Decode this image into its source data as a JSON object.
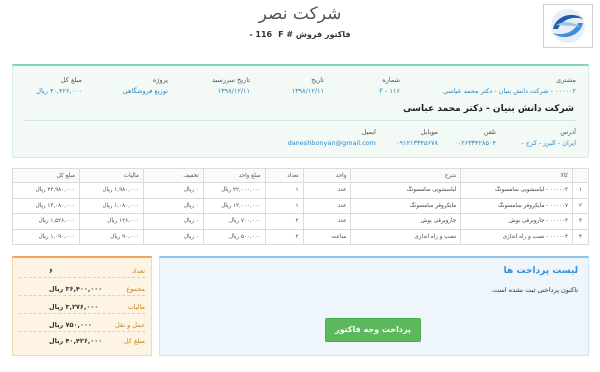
{
  "header": {
    "company_name": "شرکت نصر",
    "invoice_label": "فاکتور فروش # 116",
    "invoice_suffix": "F -"
  },
  "customer": {
    "fields": {
      "customer_label": "مشتری",
      "customer_value": "۰۰۰۰۰۲ - شرکت دانش بنیان - دکتر محمد عباسی",
      "number_label": "شماره",
      "number_value": "۱۱۶ - F",
      "date_label": "تاریخ",
      "date_value": "۱۳۹۸/۱۲/۱۱",
      "due_date_label": "تاریخ سررسید",
      "due_date_value": "۱۳۹۸/۱۲/۱۱",
      "project_label": "پروژه",
      "project_value": "توزیع فروشگاهی",
      "total_label": "مبلغ کل",
      "total_value": "۴۰,۴۲۶,۰۰۰ ریال"
    },
    "heading": "شرکت دانش بنیان - دکتر محمد عباسی",
    "contact": {
      "address_label": "آدرس",
      "address_value": "ایران - البرز - کرج -",
      "phone_label": "تلفن",
      "phone_value": "۰۲۶۳۳۴۲۸۵۰۴",
      "mobile_label": "موبایل",
      "mobile_value": "۰۹۱۲۱۳۳۴۵۶۷۸",
      "email_label": "ایمیل",
      "email_value": "daneshbonyan@gmail.com"
    }
  },
  "items_table": {
    "headers": [
      "",
      "کالا",
      "شرح",
      "واحد",
      "تعداد",
      "مبلغ واحد",
      "تخفیف",
      "مالیات",
      "مبلغ کل"
    ],
    "rows": [
      [
        "۱",
        "۰۰۰۰۰۳ - لباسشویی سامسونگ",
        "لباسشویی سامسونگ",
        "عدد",
        "۱",
        "۲۲,۰۰۰,۰۰۰ ریال",
        "۰ ریال",
        "۱,۹۸۰,۰۰۰ ریال",
        "۲۳,۹۸۰,۰۰۰ ریال"
      ],
      [
        "۲",
        "۰۰۰۰۰۷ - مایکروفر سامسونگ",
        "مایکروفر سامسونگ",
        "عدد",
        "۱",
        "۱۲,۰۰۰,۰۰۰ ریال",
        "۰ ریال",
        "۱,۰۸۰,۰۰۰ ریال",
        "۱۳,۰۸۰,۰۰۰ ریال"
      ],
      [
        "۳",
        "۰۰۰۰۰۳ - جاروبرقی بوش",
        "جاروبرقی بوش",
        "عدد",
        "۲",
        "۷۰۰,۰۰۰ ریال",
        "۰ ریال",
        "۱۲۶,۰۰۰ ریال",
        "۱,۵۲۶,۰۰۰ ریال"
      ],
      [
        "۴",
        "۰۰۰۰۰۴ - نصب و راه اندازی",
        "نصب و راه اندازی",
        "ساعت",
        "۲",
        "۵۰۰,۰۰۰ ریال",
        "۰ ریال",
        "۹۰,۰۰۰ ریال",
        "۱,۰۹۰,۰۰۰ ریال"
      ]
    ]
  },
  "totals": {
    "count_label": "تعداد",
    "count_value": "۶",
    "sum_label": "مجموع",
    "sum_value": "۳۶,۴۰۰,۰۰۰ ریال",
    "tax_label": "مالیات",
    "tax_value": "۳,۲۷۶,۰۰۰ ریال",
    "shipping_label": "حمل و نقل",
    "shipping_value": "۷۵۰,۰۰۰ ریال",
    "grand_label": "مبلغ کل",
    "grand_value": "۴۰,۴۲۶,۰۰۰ ریال"
  },
  "payments": {
    "title": "لیست پرداخت ها",
    "empty_text": "تاکنون پرداختی ثبت نشده است.",
    "pay_button_label": "پرداخت وجه فاکتور"
  },
  "colors": {
    "accent_teal": "#7fd3c0",
    "accent_orange": "#f0a35a",
    "accent_blue": "#8ec1ea",
    "link_blue": "#2b86c5",
    "pay_green": "#5cb85c"
  },
  "icons": {
    "logo": "company-logo-swirl"
  }
}
